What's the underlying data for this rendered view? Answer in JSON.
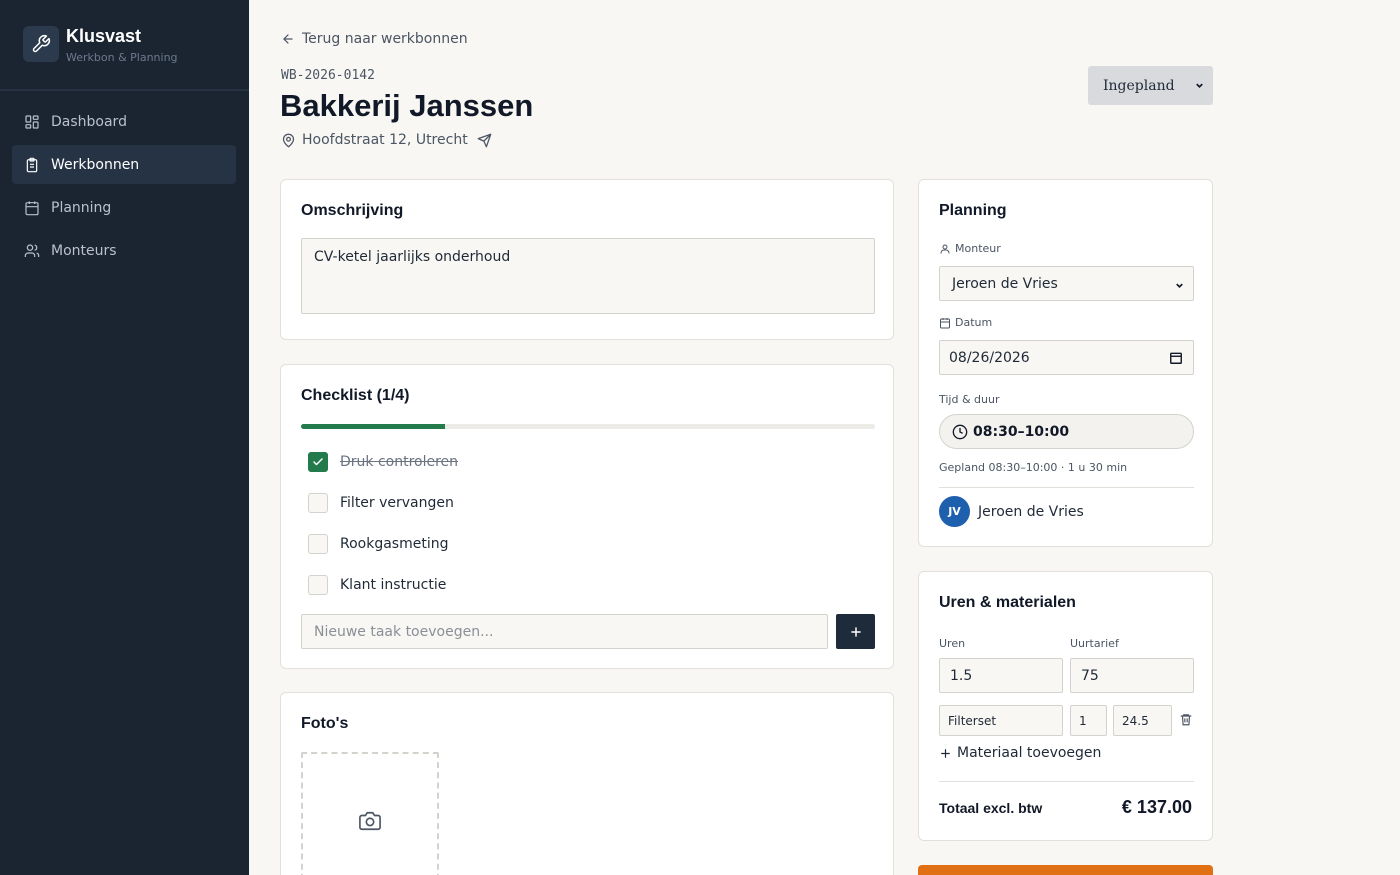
{
  "brand": {
    "name": "Klusvast",
    "subtitle": "Werkbon & Planning"
  },
  "nav": {
    "items": [
      {
        "label": "Dashboard",
        "icon": "grid-icon"
      },
      {
        "label": "Werkbonnen",
        "icon": "clipboard-icon",
        "active": true
      },
      {
        "label": "Planning",
        "icon": "calendar-icon"
      },
      {
        "label": "Monteurs",
        "icon": "users-icon"
      }
    ]
  },
  "header": {
    "back_label": "Terug naar werkbonnen",
    "work_order_number": "WB-2026-0142",
    "title": "Bakkerij Janssen",
    "address": "Hoofdstraat 12, Utrecht",
    "status": "Ingepland"
  },
  "description": {
    "title": "Omschrijving",
    "text": "CV-ketel jaarlijks onderhoud"
  },
  "checklist": {
    "title": "Checklist (1/4)",
    "progress": 0.25,
    "items": [
      {
        "label": "Druk controleren",
        "done": true
      },
      {
        "label": "Filter vervangen",
        "done": false
      },
      {
        "label": "Rookgasmeting",
        "done": false
      },
      {
        "label": "Klant instructie",
        "done": false
      }
    ],
    "new_task_placeholder": "Nieuwe taak toevoegen..."
  },
  "photos": {
    "title": "Foto's"
  },
  "planning": {
    "title": "Planning",
    "mechanic_label": "Monteur",
    "mechanic_value": "Jeroen de Vries",
    "date_label": "Datum",
    "date_value": "08/26/2026",
    "time_label": "Tijd & duur",
    "time_value": "08:30–10:00",
    "summary": "Gepland 08:30–10:00 · 1 u 30 min",
    "assignee_initials": "JV",
    "assignee_name": "Jeroen de Vries"
  },
  "hours": {
    "title": "Uren & materialen",
    "hours_label": "Uren",
    "hours_value": "1.5",
    "rate_label": "Uurtarief",
    "rate_value": "75",
    "material": {
      "name": "Filterset",
      "qty": "1",
      "price": "24.5"
    },
    "add_material_label": "Materiaal toevoegen",
    "total_label": "Totaal excl. btw",
    "total_value": "€ 137.00"
  },
  "colors": {
    "sidebar": "#1b2431",
    "accent_green": "#237a4b",
    "primary_dark": "#1e2b3b",
    "avatar_blue": "#1e5fae",
    "orange": "#e07013"
  }
}
